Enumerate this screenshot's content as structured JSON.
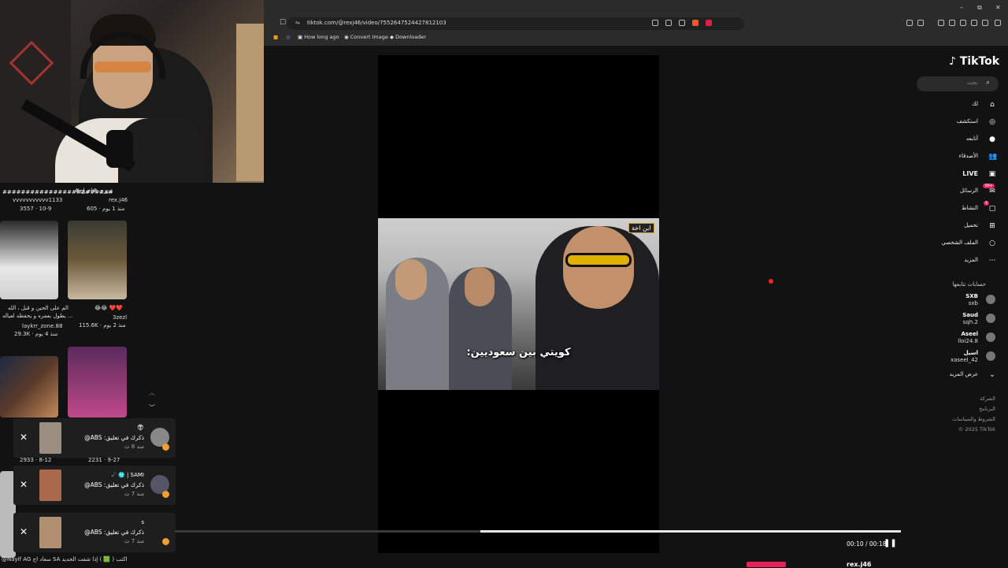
{
  "browser": {
    "url": "tiktok.com/@rexj46/video/7552647524427812103",
    "bookmarks": [
      "How long ago",
      "Convert Image",
      "Downloader"
    ],
    "window_controls": [
      "–",
      "⧉",
      "✕"
    ]
  },
  "tiktok": {
    "logo": "TikTok",
    "search_placeholder": "بحث",
    "nav": [
      {
        "label": "لك",
        "icon": "⌂"
      },
      {
        "label": "استكشف",
        "icon": "◎"
      },
      {
        "label": "أتابعه",
        "icon": "●"
      },
      {
        "label": "الأصدقاء",
        "icon": "👥"
      },
      {
        "label": "LIVE",
        "icon": "▣"
      },
      {
        "label": "الرسائل",
        "icon": "✉",
        "badge": "99+"
      },
      {
        "label": "النشاط",
        "icon": "▢",
        "badge": "9"
      },
      {
        "label": "تحميل",
        "icon": "⊞"
      },
      {
        "label": "الملف الشخصي",
        "icon": "○"
      },
      {
        "label": "المزيد",
        "icon": "···"
      }
    ],
    "following_title": "حسابات تتابعها",
    "following": [
      {
        "name": "SXB",
        "handle": "sxb"
      },
      {
        "name": "Saud",
        "handle": "sqh.2"
      },
      {
        "name": "Aseel",
        "handle": "lloi24.8"
      },
      {
        "name": "اسيل",
        "handle": "xaseel_42"
      }
    ],
    "see_more": "عرض المزيد",
    "footer": [
      "الشركة",
      "البرنامج",
      "الشروط والسياسات",
      "© 2025 TikTok"
    ],
    "video": {
      "subtitle": "كويتي بين سعوديين:",
      "logo": "ابن اخة",
      "time": "00:10 / 00:18",
      "progress": 0.56
    },
    "bottom_user": "rex.j46"
  },
  "feed": {
    "top_lines": [
      "#تي_ي #اخراج",
      "rex.j46",
      "605 · منذ 1 يوم",
      "vvvvvvvvvvv1133",
      "3557 · 10-9"
    ],
    "item1_caption": [
      "الم على الحين و قبل ، الله",
      "يطول بعمره و يحفظه لعياله ..."
    ],
    "item1_user": "laykrr_zone.88",
    "item1_meta": "29.3K · منذ 4 يوم",
    "item2_caption": "😂😂 ❤️❤️",
    "item2_user": "3zezl",
    "item2_meta": "115.6K · منذ 2 يوم",
    "row3_left": "2933 · 8-12",
    "row3_right": "2231 · 9-27",
    "bottom_text": "@Nayif AG سعاد اج SA   اكتب ( 🟩 ) إذا شفت الجديد"
  },
  "notifications": [
    {
      "name": "👽",
      "text": "ذكرك في تعليق: ABS@",
      "time": "منذ 8 ث"
    },
    {
      "name": "SAMI | ⛎ ☄",
      "text": "ذكرك في تعليق: ABS@",
      "time": "منذ 7 ث"
    },
    {
      "name": "s",
      "text": "ذكرك في تعليق: ABS@",
      "time": "منذ 7 ث"
    }
  ]
}
